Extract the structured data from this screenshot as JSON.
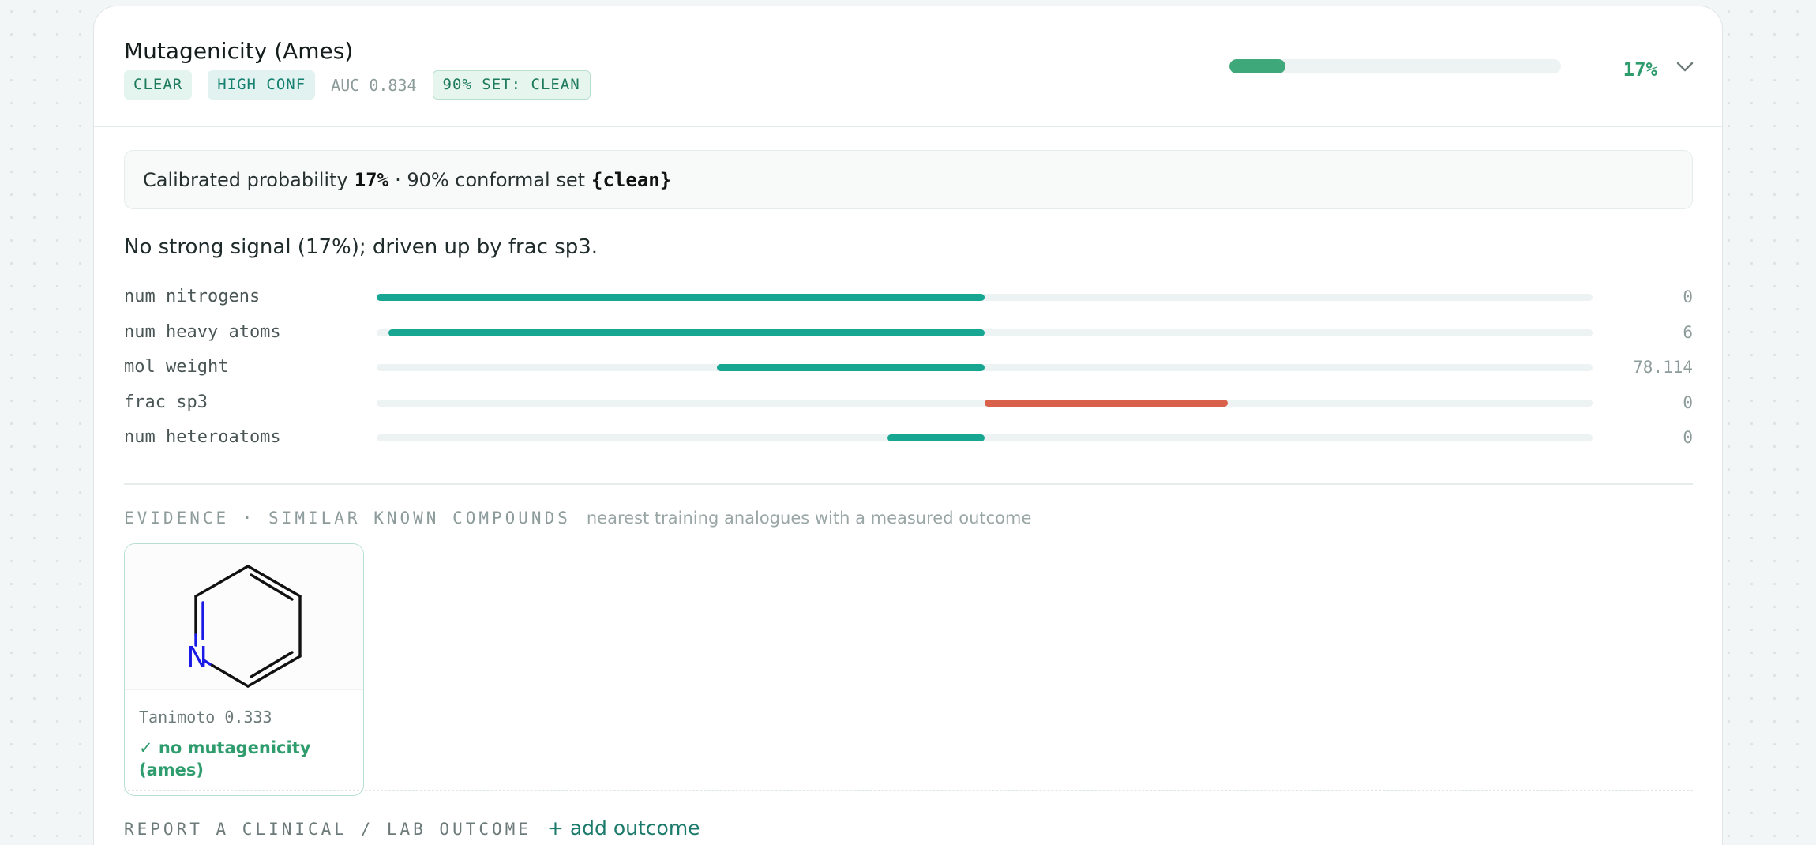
{
  "panel": {
    "title": "Mutagenicity (Ames)",
    "badges": [
      "CLEAR",
      "HIGH CONF"
    ],
    "auc": "AUC 0.834",
    "set_badge": "90% SET: CLEAN",
    "probability_fraction": 0.17,
    "probability_label": "17%"
  },
  "summary": {
    "prefix": "Calibrated probability",
    "probability": "17%",
    "middle": "· 90% conformal set",
    "set": "{clean}"
  },
  "signal_text": "No strong signal (17%); driven up by frac sp3.",
  "features": [
    {
      "name": "num nitrogens",
      "value": "0",
      "contribution": -1.0
    },
    {
      "name": "num heavy atoms",
      "value": "6",
      "contribution": -0.98
    },
    {
      "name": "mol weight",
      "value": "78.114",
      "contribution": -0.44
    },
    {
      "name": "frac sp3",
      "value": "0",
      "contribution": 0.4
    },
    {
      "name": "num heteroatoms",
      "value": "0",
      "contribution": -0.16
    }
  ],
  "colors": {
    "negative": "#17a692",
    "positive": "#d9604a",
    "accent": "#3ea87a"
  },
  "evidence": {
    "label": "EVIDENCE · SIMILAR KNOWN COMPOUNDS",
    "subtitle": "nearest training analogues with a measured outcome",
    "compounds": [
      {
        "atom_label": "N",
        "tanimoto": "Tanimoto 0.333",
        "outcome": "✓ no mutagenicity (ames)"
      }
    ]
  },
  "report": {
    "label": "REPORT A CLINICAL / LAB OUTCOME",
    "add_label": "+ add outcome"
  }
}
